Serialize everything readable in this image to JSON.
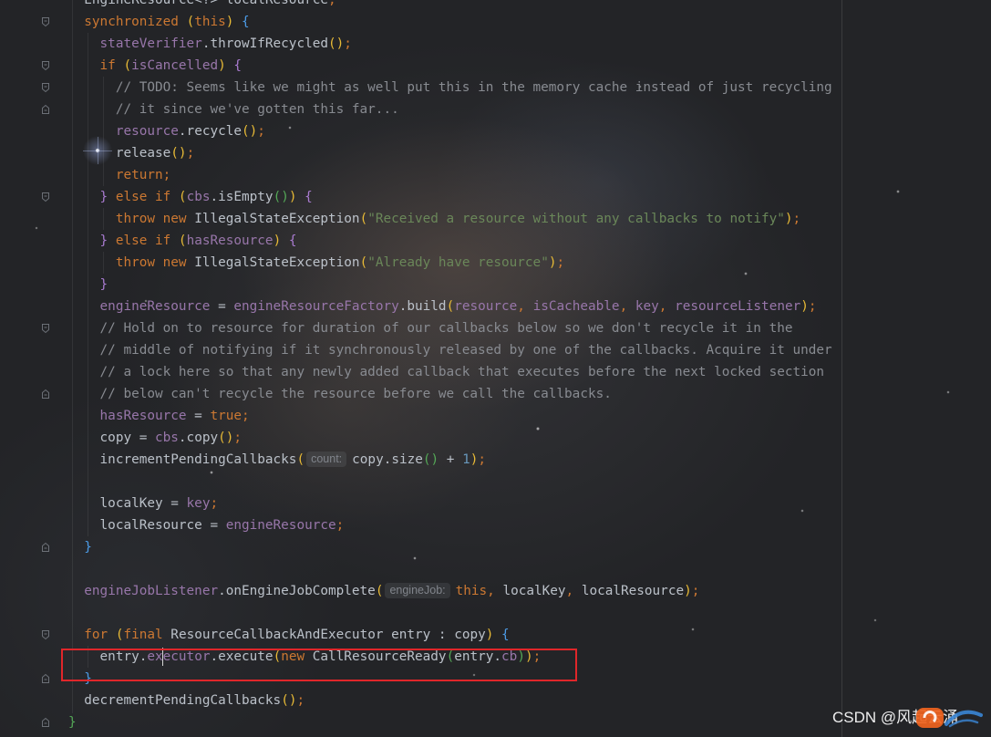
{
  "editor": {
    "lines": [
      {
        "tokens": [
          {
            "t": "  ",
            "k": "ws"
          },
          {
            "t": "EngineResource<?> localResource",
            "k": "plain"
          },
          {
            "t": ";",
            "k": "punct"
          }
        ]
      },
      {
        "tokens": [
          {
            "t": "  ",
            "k": "ws"
          },
          {
            "t": "synchronized",
            "k": "kw"
          },
          {
            "t": " ",
            "k": "ws"
          },
          {
            "t": "(",
            "k": "p1"
          },
          {
            "t": "this",
            "k": "kw"
          },
          {
            "t": ")",
            "k": "p1"
          },
          {
            "t": " ",
            "k": "ws"
          },
          {
            "t": "{",
            "k": "b2"
          }
        ]
      },
      {
        "tokens": [
          {
            "t": "    ",
            "k": "ws"
          },
          {
            "t": "stateVerifier",
            "k": "field"
          },
          {
            "t": ".throwIfRecycled",
            "k": "plain"
          },
          {
            "t": "()",
            "k": "p1"
          },
          {
            "t": ";",
            "k": "punct"
          }
        ]
      },
      {
        "tokens": [
          {
            "t": "    ",
            "k": "ws"
          },
          {
            "t": "if",
            "k": "kw"
          },
          {
            "t": " ",
            "k": "ws"
          },
          {
            "t": "(",
            "k": "p1"
          },
          {
            "t": "isCancelled",
            "k": "field"
          },
          {
            "t": ")",
            "k": "p1"
          },
          {
            "t": " ",
            "k": "ws"
          },
          {
            "t": "{",
            "k": "b3"
          }
        ]
      },
      {
        "tokens": [
          {
            "t": "      ",
            "k": "ws"
          },
          {
            "t": "// TODO: Seems like we might as well put this in the memory cache instead of just recycling",
            "k": "comment"
          }
        ]
      },
      {
        "tokens": [
          {
            "t": "      ",
            "k": "ws"
          },
          {
            "t": "// it since we've gotten this far...",
            "k": "comment"
          }
        ]
      },
      {
        "tokens": [
          {
            "t": "      ",
            "k": "ws"
          },
          {
            "t": "resource",
            "k": "field"
          },
          {
            "t": ".recycle",
            "k": "plain"
          },
          {
            "t": "()",
            "k": "p1"
          },
          {
            "t": ";",
            "k": "punct"
          }
        ]
      },
      {
        "tokens": [
          {
            "t": "      ",
            "k": "ws"
          },
          {
            "t": "release",
            "k": "plain"
          },
          {
            "t": "()",
            "k": "p1"
          },
          {
            "t": ";",
            "k": "punct"
          }
        ]
      },
      {
        "tokens": [
          {
            "t": "      ",
            "k": "ws"
          },
          {
            "t": "return",
            "k": "kw"
          },
          {
            "t": ";",
            "k": "punct"
          }
        ]
      },
      {
        "tokens": [
          {
            "t": "    ",
            "k": "ws"
          },
          {
            "t": "}",
            "k": "b3"
          },
          {
            "t": " ",
            "k": "ws"
          },
          {
            "t": "else if",
            "k": "kw"
          },
          {
            "t": " ",
            "k": "ws"
          },
          {
            "t": "(",
            "k": "p1"
          },
          {
            "t": "cbs",
            "k": "field"
          },
          {
            "t": ".isEmpty",
            "k": "plain"
          },
          {
            "t": "()",
            "k": "p2"
          },
          {
            "t": ")",
            "k": "p1"
          },
          {
            "t": " ",
            "k": "ws"
          },
          {
            "t": "{",
            "k": "b3"
          }
        ]
      },
      {
        "tokens": [
          {
            "t": "      ",
            "k": "ws"
          },
          {
            "t": "throw new",
            "k": "kw"
          },
          {
            "t": " IllegalStateException",
            "k": "plain"
          },
          {
            "t": "(",
            "k": "p1"
          },
          {
            "t": "\"Received a resource without any callbacks to notify\"",
            "k": "string"
          },
          {
            "t": ")",
            "k": "p1"
          },
          {
            "t": ";",
            "k": "punct"
          }
        ]
      },
      {
        "tokens": [
          {
            "t": "    ",
            "k": "ws"
          },
          {
            "t": "}",
            "k": "b3"
          },
          {
            "t": " ",
            "k": "ws"
          },
          {
            "t": "else if",
            "k": "kw"
          },
          {
            "t": " ",
            "k": "ws"
          },
          {
            "t": "(",
            "k": "p1"
          },
          {
            "t": "hasResource",
            "k": "field"
          },
          {
            "t": ")",
            "k": "p1"
          },
          {
            "t": " ",
            "k": "ws"
          },
          {
            "t": "{",
            "k": "b3"
          }
        ]
      },
      {
        "tokens": [
          {
            "t": "      ",
            "k": "ws"
          },
          {
            "t": "throw new",
            "k": "kw"
          },
          {
            "t": " IllegalStateException",
            "k": "plain"
          },
          {
            "t": "(",
            "k": "p1"
          },
          {
            "t": "\"Already have resource\"",
            "k": "string"
          },
          {
            "t": ")",
            "k": "p1"
          },
          {
            "t": ";",
            "k": "punct"
          }
        ]
      },
      {
        "tokens": [
          {
            "t": "    ",
            "k": "ws"
          },
          {
            "t": "}",
            "k": "b3"
          }
        ]
      },
      {
        "tokens": [
          {
            "t": "    ",
            "k": "ws"
          },
          {
            "t": "engineResource",
            "k": "field"
          },
          {
            "t": " = ",
            "k": "plain"
          },
          {
            "t": "engineResourceFactory",
            "k": "field"
          },
          {
            "t": ".build",
            "k": "plain"
          },
          {
            "t": "(",
            "k": "p1"
          },
          {
            "t": "resource",
            "k": "field"
          },
          {
            "t": ",",
            "k": "punct"
          },
          {
            "t": " ",
            "k": "ws"
          },
          {
            "t": "isCacheable",
            "k": "field"
          },
          {
            "t": ",",
            "k": "punct"
          },
          {
            "t": " ",
            "k": "ws"
          },
          {
            "t": "key",
            "k": "field"
          },
          {
            "t": ",",
            "k": "punct"
          },
          {
            "t": " ",
            "k": "ws"
          },
          {
            "t": "resourceListener",
            "k": "field"
          },
          {
            "t": ")",
            "k": "p1"
          },
          {
            "t": ";",
            "k": "punct"
          }
        ]
      },
      {
        "tokens": [
          {
            "t": "    ",
            "k": "ws"
          },
          {
            "t": "// Hold on to resource for duration of our callbacks below so we don't recycle it in the",
            "k": "comment"
          }
        ]
      },
      {
        "tokens": [
          {
            "t": "    ",
            "k": "ws"
          },
          {
            "t": "// middle of notifying if it synchronously released by one of the callbacks. Acquire it under",
            "k": "comment"
          }
        ]
      },
      {
        "tokens": [
          {
            "t": "    ",
            "k": "ws"
          },
          {
            "t": "// a lock here so that any newly added callback that executes before the next locked section",
            "k": "comment"
          }
        ]
      },
      {
        "tokens": [
          {
            "t": "    ",
            "k": "ws"
          },
          {
            "t": "// below can't recycle the resource before we call the callbacks.",
            "k": "comment"
          }
        ]
      },
      {
        "tokens": [
          {
            "t": "    ",
            "k": "ws"
          },
          {
            "t": "hasResource",
            "k": "field"
          },
          {
            "t": " = ",
            "k": "plain"
          },
          {
            "t": "true",
            "k": "kw"
          },
          {
            "t": ";",
            "k": "punct"
          }
        ]
      },
      {
        "tokens": [
          {
            "t": "    ",
            "k": "ws"
          },
          {
            "t": "copy = ",
            "k": "plain"
          },
          {
            "t": "cbs",
            "k": "field"
          },
          {
            "t": ".copy",
            "k": "plain"
          },
          {
            "t": "()",
            "k": "p1"
          },
          {
            "t": ";",
            "k": "punct"
          }
        ]
      },
      {
        "tokens": [
          {
            "t": "    ",
            "k": "ws"
          },
          {
            "t": "incrementPendingCallbacks",
            "k": "plain"
          },
          {
            "t": "(",
            "k": "p1"
          },
          {
            "t": "count:",
            "k": "hint"
          },
          {
            "t": "copy.size",
            "k": "plain"
          },
          {
            "t": "()",
            "k": "p2"
          },
          {
            "t": " + ",
            "k": "plain"
          },
          {
            "t": "1",
            "k": "num"
          },
          {
            "t": ")",
            "k": "p1"
          },
          {
            "t": ";",
            "k": "punct"
          }
        ]
      },
      {
        "tokens": []
      },
      {
        "tokens": [
          {
            "t": "    ",
            "k": "ws"
          },
          {
            "t": "localKey = ",
            "k": "plain"
          },
          {
            "t": "key",
            "k": "field"
          },
          {
            "t": ";",
            "k": "punct"
          }
        ]
      },
      {
        "tokens": [
          {
            "t": "    ",
            "k": "ws"
          },
          {
            "t": "localResource = ",
            "k": "plain"
          },
          {
            "t": "engineResource",
            "k": "field"
          },
          {
            "t": ";",
            "k": "punct"
          }
        ]
      },
      {
        "tokens": [
          {
            "t": "  ",
            "k": "ws"
          },
          {
            "t": "}",
            "k": "b2"
          }
        ]
      },
      {
        "tokens": []
      },
      {
        "tokens": [
          {
            "t": "  ",
            "k": "ws"
          },
          {
            "t": "engineJobListener",
            "k": "field"
          },
          {
            "t": ".onEngineJobComplete",
            "k": "plain"
          },
          {
            "t": "(",
            "k": "p1"
          },
          {
            "t": "engineJob:",
            "k": "hint"
          },
          {
            "t": "this",
            "k": "kw"
          },
          {
            "t": ",",
            "k": "punct"
          },
          {
            "t": " localKey",
            "k": "plain"
          },
          {
            "t": ",",
            "k": "punct"
          },
          {
            "t": " localResource",
            "k": "plain"
          },
          {
            "t": ")",
            "k": "p1"
          },
          {
            "t": ";",
            "k": "punct"
          }
        ]
      },
      {
        "tokens": []
      },
      {
        "tokens": [
          {
            "t": "  ",
            "k": "ws"
          },
          {
            "t": "for",
            "k": "kw"
          },
          {
            "t": " ",
            "k": "ws"
          },
          {
            "t": "(",
            "k": "p1"
          },
          {
            "t": "final",
            "k": "kw"
          },
          {
            "t": " ResourceCallbackAndExecutor entry : copy",
            "k": "plain"
          },
          {
            "t": ")",
            "k": "p1"
          },
          {
            "t": " ",
            "k": "ws"
          },
          {
            "t": "{",
            "k": "b2"
          }
        ]
      },
      {
        "tokens": [
          {
            "t": "    ",
            "k": "ws"
          },
          {
            "t": "entry.",
            "k": "plain"
          },
          {
            "t": "executor",
            "k": "field"
          },
          {
            "t": ".execute",
            "k": "plain"
          },
          {
            "t": "(",
            "k": "p1"
          },
          {
            "t": "new",
            "k": "kw"
          },
          {
            "t": " CallResourceReady",
            "k": "plain"
          },
          {
            "t": "(",
            "k": "p2"
          },
          {
            "t": "entry.",
            "k": "plain"
          },
          {
            "t": "cb",
            "k": "field"
          },
          {
            "t": ")",
            "k": "p2"
          },
          {
            "t": ")",
            "k": "p1"
          },
          {
            "t": ";",
            "k": "punct"
          }
        ]
      },
      {
        "tokens": [
          {
            "t": "  ",
            "k": "ws"
          },
          {
            "t": "}",
            "k": "b2"
          }
        ]
      },
      {
        "tokens": [
          {
            "t": "  ",
            "k": "ws"
          },
          {
            "t": "decrementPendingCallbacks",
            "k": "plain"
          },
          {
            "t": "()",
            "k": "p1"
          },
          {
            "t": ";",
            "k": "punct"
          }
        ]
      },
      {
        "tokens": [
          {
            "t": "}",
            "k": "b1"
          }
        ]
      }
    ]
  },
  "syntax_colors": {
    "kw": "#CC7832",
    "field": "#9876AA",
    "plain": "#BBC1C9",
    "comment": "#888B91",
    "string": "#6A8759",
    "num": "#6897BB",
    "punct": "#CC7832",
    "hint": "#80848B",
    "p1": "#E8BA36",
    "p2": "#54A857",
    "b1": "#54A857",
    "b2": "#4C9BE6",
    "b3": "#A97BD0"
  },
  "icons": {
    "fold_marker": "fold-marker-icon",
    "logo": "csdn-logo"
  },
  "annotation": {
    "box_color": "#E0262A"
  },
  "watermark": {
    "text": "CSDN @风起云涌",
    "logo_colors": [
      "#F0641E",
      "#3A86D6"
    ]
  }
}
